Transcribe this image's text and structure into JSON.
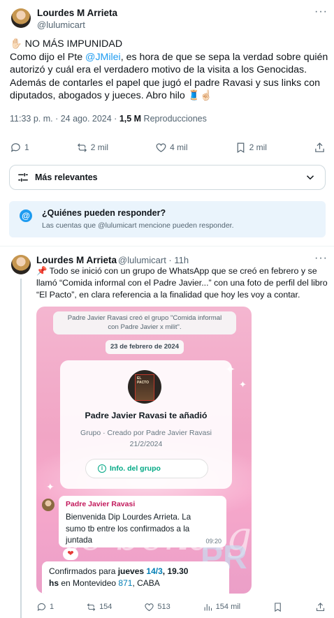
{
  "main_tweet": {
    "name": "Lourdes M Arrieta",
    "handle": "@lulumicart",
    "more": "···",
    "line1": "✋🏻 NO MÁS IMPUNIDAD",
    "line2_pre": "Como dijo el Pte ",
    "line2_mention": "@JMilei",
    "line2_post": ", es hora de que se sepa la verdad sobre quién",
    "line3": "autorizó y cuál era el verdadero motivo de la visita a los Genocidas.",
    "line4": "Además de contarles el papel que jugó el padre Ravasi y sus links con",
    "line5": "diputados, abogados y  jueces. Abro hilo 🧵☝🏻",
    "time": "11:33 p. m. · 24 ago. 2024 · ",
    "views_count": "1,5 M",
    "views_label": " Reproducciones",
    "replies": "1",
    "reposts": "2 mil",
    "likes": "4 mil",
    "bookmarks": "2 mil"
  },
  "sort": {
    "label": "Más relevantes"
  },
  "reply_restriction": {
    "title": "¿Quiénes pueden responder?",
    "subtitle": "Las cuentas que @lulumicart mencione pueden responder."
  },
  "reply_tweet": {
    "name": "Lourdes M Arrieta",
    "handle": "@lulumicart · 11h",
    "more": "···",
    "line1": "📌 Todo se inició con un grupo de WhatsApp que se creó en febrero y se",
    "line2": "llamó “Comida informal con el Padre Javier...” con una foto de perfil del libro",
    "line3": "“El Pacto”, en clara referencia a la finalidad que hoy les voy a contar.",
    "replies": "1",
    "reposts": "154",
    "likes": "513",
    "views": "154 mil"
  },
  "screenshot": {
    "system_line1": "Padre Javier Ravasi creó el grupo \"Comida informal",
    "system_line2": "con Padre Javier x milit\".",
    "date": "23 de febrero de 2024",
    "book_text": "EL PACTO",
    "group_title": "Padre Javier Ravasi te añadió",
    "group_sub1": "Grupo · Creado por Padre Javier Ravasi",
    "group_sub2": "21/2/2024",
    "info_button": "Info. del grupo",
    "msg_sender": "Padre Javier Ravasi",
    "msg_line1": "Bienvenida Dip Lourdes Arrieta. La",
    "msg_line2": "sumo tb entre los confirmados a la",
    "msg_line3": "juntada",
    "msg_time": "09:20",
    "reaction": "❤",
    "msg2_pre": "Confirmados para ",
    "msg2_bold": "jueves ",
    "msg2_date": "14/3",
    "msg2_time": ", 19.30",
    "msg2_line2_pre": "hs",
    "msg2_line2_mid": " en Montevideo ",
    "msg2_number": "871",
    "msg2_line2_post": ", CABA",
    "deco_text": "te bendiga",
    "deco_text2": "PR"
  },
  "colors": {
    "accent": "#1d9bf0",
    "secondary_text": "#536471",
    "whatsapp_green": "#00a884",
    "background_pink": "#f1a5c5"
  }
}
